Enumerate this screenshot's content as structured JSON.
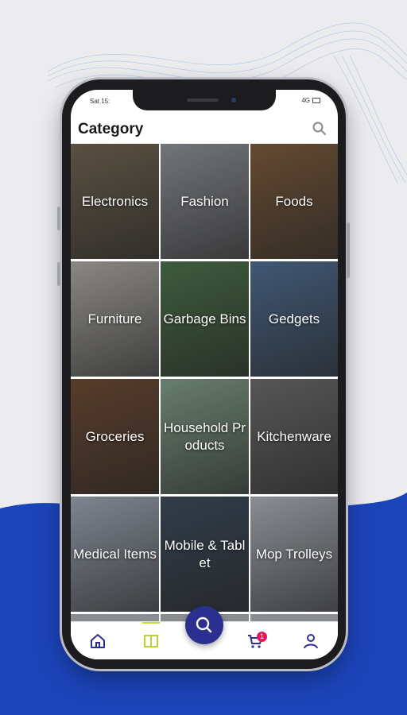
{
  "status_bar": {
    "left_text": "Sat 15:",
    "signal_text": "4G"
  },
  "header": {
    "title": "Category",
    "search_icon": "search-icon"
  },
  "categories": [
    {
      "label": "Electronics",
      "bg": "#6e6250"
    },
    {
      "label": "Fashion",
      "bg": "#8c8f94"
    },
    {
      "label": "Foods",
      "bg": "#7a5a3c"
    },
    {
      "label": "Furniture",
      "bg": "#a9a6a0"
    },
    {
      "label": "Garbage Bins",
      "bg": "#4c6f4a"
    },
    {
      "label": "Gedgets",
      "bg": "#4f6b8e"
    },
    {
      "label": "Groceries",
      "bg": "#6b4a34"
    },
    {
      "label": "Household Products",
      "bg": "#7f9a86"
    },
    {
      "label": "Kitchenware",
      "bg": "#6a6a6c"
    },
    {
      "label": "Medical Items",
      "bg": "#9aa3b0"
    },
    {
      "label": "Mobile & Tablet",
      "bg": "#3c4a5a"
    },
    {
      "label": "Mop Trolleys",
      "bg": "#a8adb5"
    }
  ],
  "bottom_nav": {
    "items": [
      {
        "name": "home",
        "icon": "home-icon"
      },
      {
        "name": "categories",
        "icon": "book-icon",
        "active": true
      },
      {
        "name": "cart",
        "icon": "cart-icon"
      },
      {
        "name": "profile",
        "icon": "user-icon"
      }
    ],
    "cart_badge": "1",
    "fab_icon": "search-icon"
  },
  "colors": {
    "accent": "#2b2f8f",
    "active": "#c5e232",
    "badge": "#e2195b"
  }
}
